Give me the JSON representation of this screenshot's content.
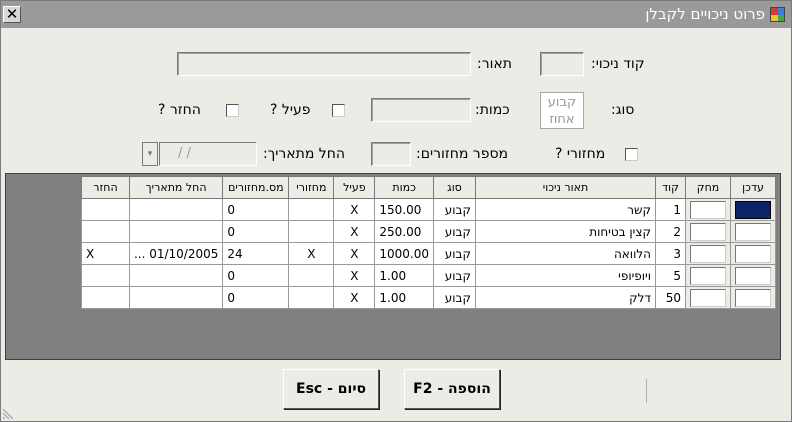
{
  "window": {
    "title": "פרוט ניכויים לקבלן",
    "close_glyph": "✕"
  },
  "form": {
    "code_label": "קוד ניכוי:",
    "code_value": "",
    "desc_label": "תאור:",
    "desc_value": "",
    "type_label": "סוג:",
    "type_option_1": "קבוע",
    "type_option_2": "אחוז",
    "qty_label": "כמות:",
    "qty_value": "",
    "active_label": "פעיל ?",
    "return_label": "החזר ?",
    "recurring_label": "מחזורי ?",
    "cycles_label": "מספר מחזורים:",
    "cycles_value": "",
    "start_date_label": "החל מתאריך:",
    "start_date_value": "/ /",
    "dropdown_glyph": "▾"
  },
  "grid": {
    "headers": {
      "update": "עדכן",
      "delete": "מחק",
      "code": "קוד",
      "desc": "תאור ניכוי",
      "type": "סוג",
      "qty": "כמות",
      "active": "פעיל",
      "recurring": "מחזורי",
      "cycles": "מס.מחזורים",
      "start_date": "החל מתאריך",
      "return": "החזר"
    },
    "rows": [
      {
        "code": "1",
        "desc": "קשר",
        "type": "קבוע",
        "qty": "150.00",
        "active": "X",
        "recurring": "",
        "cycles": "0",
        "start_date": "",
        "return": ""
      },
      {
        "code": "2",
        "desc": "קצין בטיחות",
        "type": "קבוע",
        "qty": "250.00",
        "active": "X",
        "recurring": "",
        "cycles": "0",
        "start_date": "",
        "return": ""
      },
      {
        "code": "3",
        "desc": "הלוואה",
        "type": "קבוע",
        "qty": "1000.00",
        "active": "X",
        "recurring": "X",
        "cycles": "24",
        "start_date": "01/10/2005 ...",
        "return": "X"
      },
      {
        "code": "5",
        "desc": "ויופיופי",
        "type": "קבוע",
        "qty": "1.00",
        "active": "X",
        "recurring": "",
        "cycles": "0",
        "start_date": "",
        "return": ""
      },
      {
        "code": "50",
        "desc": "דלק",
        "type": "קבוע",
        "qty": "1.00",
        "active": "X",
        "recurring": "",
        "cycles": "0",
        "start_date": "",
        "return": ""
      }
    ]
  },
  "buttons": {
    "add_label": "הוספה - F2",
    "finish_label": "סיום - Esc"
  }
}
